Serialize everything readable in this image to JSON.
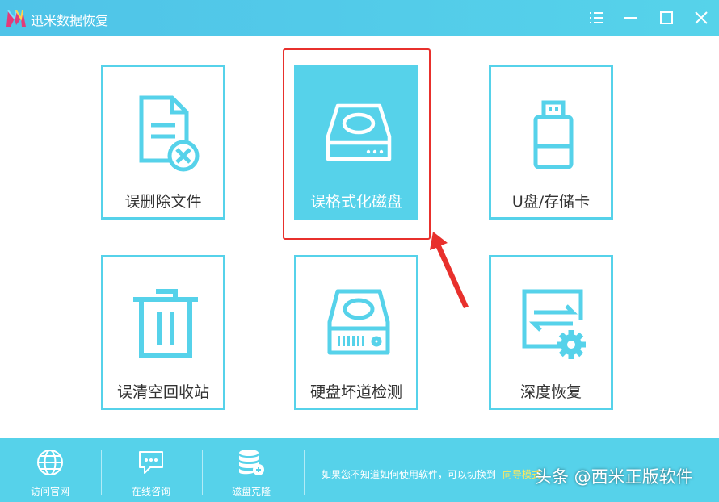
{
  "app": {
    "title": "迅米数据恢复",
    "colors": {
      "accent": "#56d2ea",
      "highlight": "#e8302c",
      "link": "#ffe95b"
    }
  },
  "window_controls": {
    "menu_icon": "menu-icon",
    "minimize_icon": "minimize-icon",
    "maximize_icon": "maximize-icon",
    "close_icon": "close-icon"
  },
  "cards": [
    {
      "label": "误删除文件",
      "icon": "deleted-file-icon",
      "selected": false
    },
    {
      "label": "误格式化磁盘",
      "icon": "disk-icon",
      "selected": true
    },
    {
      "label": "U盘/存储卡",
      "icon": "usb-drive-icon",
      "selected": false
    },
    {
      "label": "误清空回收站",
      "icon": "trash-icon",
      "selected": false
    },
    {
      "label": "硬盘坏道检测",
      "icon": "hard-drive-icon",
      "selected": false
    },
    {
      "label": "深度恢复",
      "icon": "deep-recovery-icon",
      "selected": false
    }
  ],
  "bottom": {
    "items": [
      {
        "label": "访问官网",
        "icon": "globe-icon"
      },
      {
        "label": "在线咨询",
        "icon": "chat-icon"
      },
      {
        "label": "磁盘克隆",
        "icon": "database-clone-icon"
      }
    ],
    "hint": "如果您不知道如何使用软件，可以切换到",
    "hint_link": "向导模式",
    "watermark": "头条 @西米正版软件"
  }
}
